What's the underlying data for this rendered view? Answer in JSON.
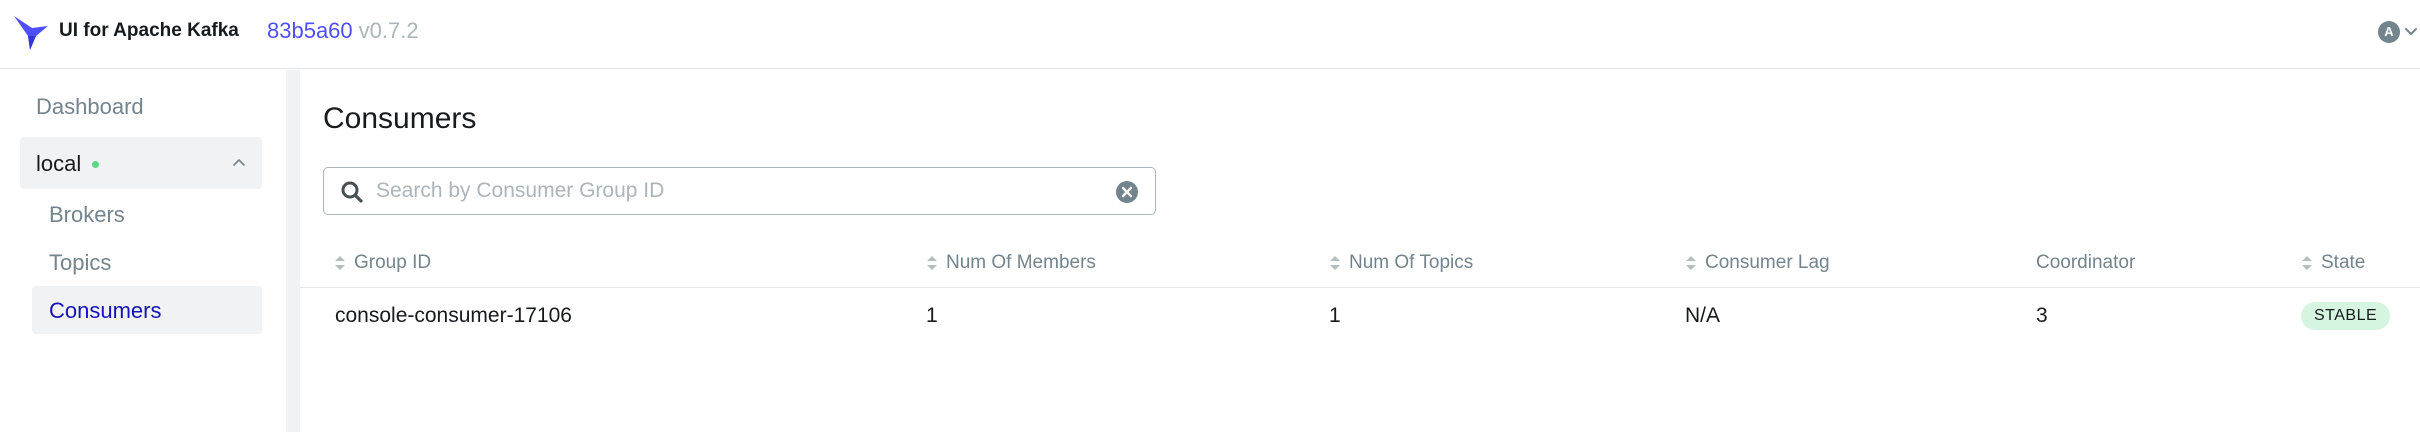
{
  "header": {
    "app_title": "UI for Apache Kafka",
    "version_hash": "83b5a60",
    "version": "v0.7.2",
    "user_initial": "A"
  },
  "sidebar": {
    "dashboard": "Dashboard",
    "cluster_name": "local",
    "cluster_status_color": "#5cd685",
    "items": [
      {
        "label": "Brokers"
      },
      {
        "label": "Topics"
      },
      {
        "label": "Consumers",
        "active": true
      }
    ]
  },
  "main": {
    "title": "Consumers",
    "search": {
      "placeholder": "Search by Consumer Group ID",
      "value": ""
    },
    "table": {
      "columns": [
        "Group ID",
        "Num Of Members",
        "Num Of Topics",
        "Consumer Lag",
        "Coordinator",
        "State"
      ],
      "rows": [
        {
          "group_id": "console-consumer-17106",
          "members": "1",
          "topics": "1",
          "lag": "N/A",
          "coordinator": "3",
          "state": "STABLE"
        }
      ]
    }
  },
  "colors": {
    "accent": "#4f4ffa",
    "active_nav": "#1414b8",
    "state_stable_bg": "#d6f5e0"
  }
}
